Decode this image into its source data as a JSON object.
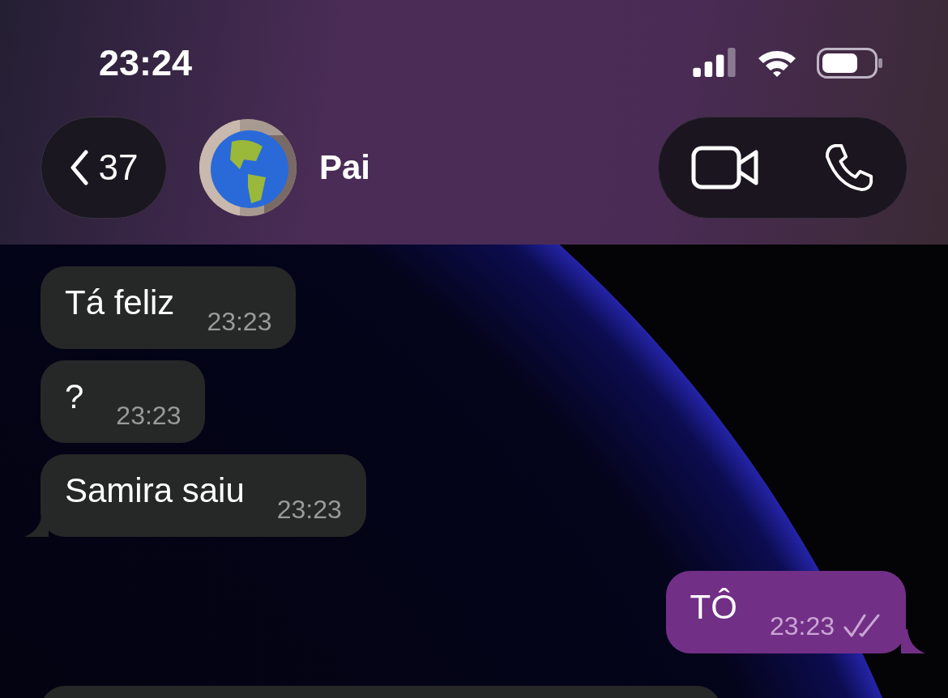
{
  "status_bar": {
    "time": "23:24"
  },
  "header": {
    "back_count": "37",
    "contact_name": "Pai"
  },
  "messages": [
    {
      "sent": false,
      "text": "Tá feliz",
      "time": "23:23",
      "tail": false
    },
    {
      "sent": false,
      "text": "?",
      "time": "23:23",
      "tail": false
    },
    {
      "sent": false,
      "text": "Samira saiu",
      "time": "23:23",
      "tail": true
    },
    {
      "sent": true,
      "text": "TÔ",
      "time": "23:23",
      "tail": true,
      "read": true
    },
    {
      "sent": false,
      "cut": true
    }
  ]
}
